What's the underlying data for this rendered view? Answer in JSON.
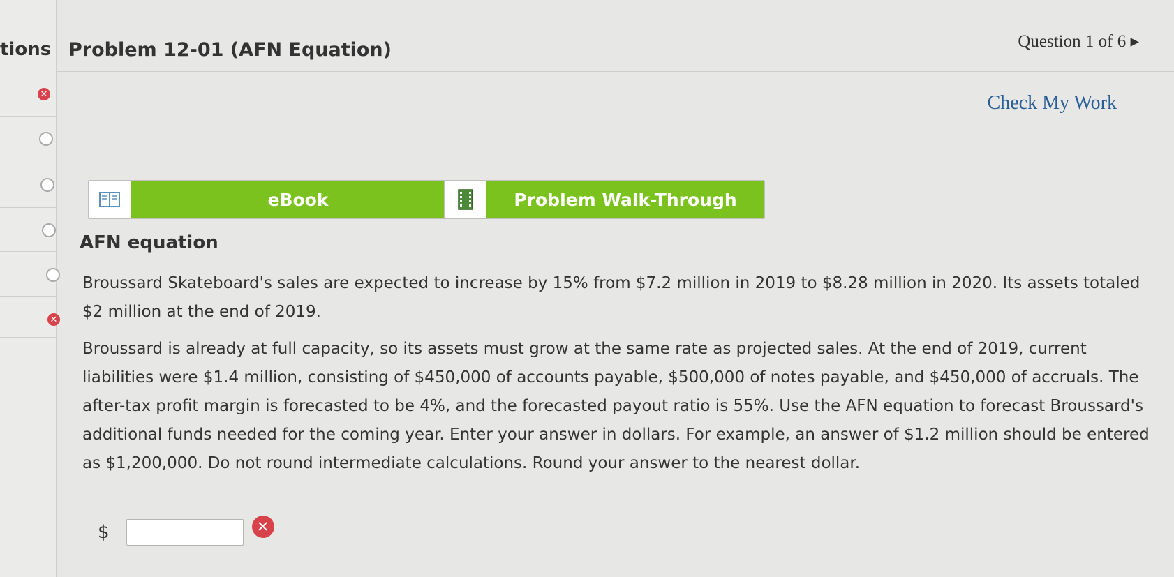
{
  "sidebar": {
    "title": "tions",
    "items": [
      {
        "status": "wrong",
        "icon": "error-icon"
      },
      {
        "status": "open",
        "icon": "circle-icon"
      },
      {
        "status": "open",
        "icon": "circle-icon"
      },
      {
        "status": "open",
        "icon": "circle-icon"
      },
      {
        "status": "open",
        "icon": "circle-icon"
      },
      {
        "status": "wrong",
        "icon": "error-icon"
      }
    ]
  },
  "header": {
    "title": "Problem 12-01 (AFN Equation)",
    "question_counter": "Question 1 of 6 ▸"
  },
  "check_my_work": "Check My Work",
  "tools": {
    "ebook_label": "eBook",
    "walkthrough_label": "Problem Walk-Through"
  },
  "problem": {
    "heading": "AFN equation",
    "paragraph1": "Broussard Skateboard's sales are expected to increase by 15% from $7.2 million in 2019 to $8.28 million in 2020. Its assets totaled $2 million at the end of 2019.",
    "paragraph2": "Broussard is already at full capacity, so its assets must grow at the same rate as projected sales. At the end of 2019, current liabilities were $1.4 million, consisting of $450,000 of accounts payable, $500,000 of notes payable, and $450,000 of accruals. The after-tax profit margin is forecasted to be 4%, and the forecasted payout ratio is 55%. Use the AFN equation to forecast Broussard's additional funds needed for the coming year. Enter your answer in dollars. For example, an answer of $1.2 million should be entered as $1,200,000. Do not round intermediate calculations. Round your answer to the nearest dollar."
  },
  "answer": {
    "currency_symbol": "$",
    "value": "",
    "status": "incorrect"
  },
  "colors": {
    "accent_green": "#7bc21e",
    "link_blue": "#2a5e98",
    "error_red": "#d8424a"
  }
}
